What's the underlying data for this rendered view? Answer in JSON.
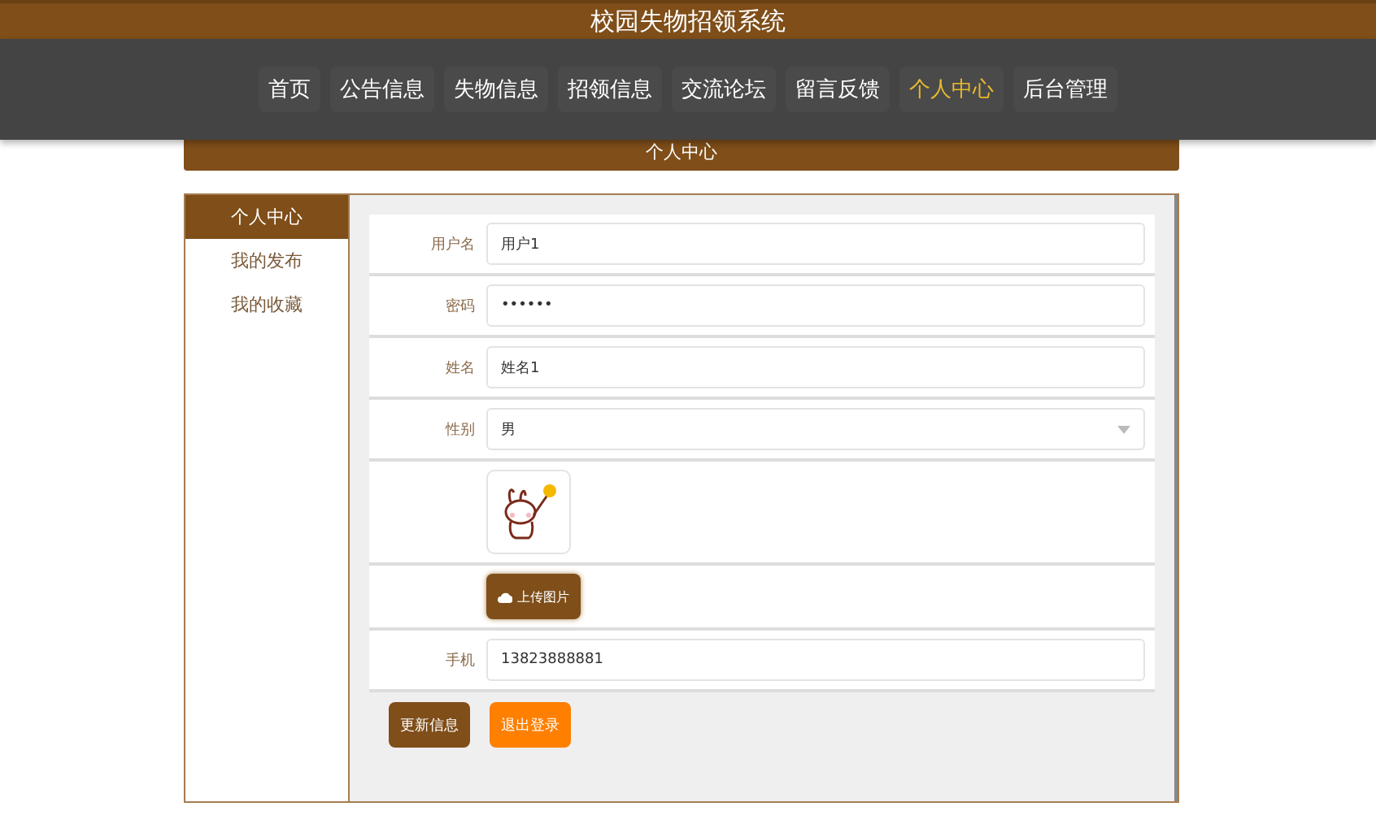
{
  "site_title": "校园失物招领系统",
  "nav": [
    {
      "label": "首页",
      "selected": false
    },
    {
      "label": "公告信息",
      "selected": false
    },
    {
      "label": "失物信息",
      "selected": false
    },
    {
      "label": "招领信息",
      "selected": false
    },
    {
      "label": "交流论坛",
      "selected": false
    },
    {
      "label": "留言反馈",
      "selected": false
    },
    {
      "label": "个人中心",
      "selected": true
    },
    {
      "label": "后台管理",
      "selected": false
    }
  ],
  "page_title": "个人中心",
  "sidebar": [
    {
      "label": "个人中心",
      "selected": true
    },
    {
      "label": "我的发布",
      "selected": false
    },
    {
      "label": "我的收藏",
      "selected": false
    }
  ],
  "form": [
    {
      "kind": "text",
      "label": "用户名",
      "value": "用户1"
    },
    {
      "kind": "password",
      "label": "密码",
      "value": "••••••"
    },
    {
      "kind": "text",
      "label": "姓名",
      "value": "姓名1"
    },
    {
      "kind": "select",
      "label": "性别",
      "value": "男"
    },
    {
      "kind": "image"
    },
    {
      "kind": "upload",
      "button": "上传图片"
    },
    {
      "kind": "text",
      "label": "手机",
      "value": "13823888881"
    }
  ],
  "buttons": [
    {
      "label": "更新信息",
      "kind": "primary"
    },
    {
      "label": "退出登录",
      "kind": "danger"
    }
  ]
}
